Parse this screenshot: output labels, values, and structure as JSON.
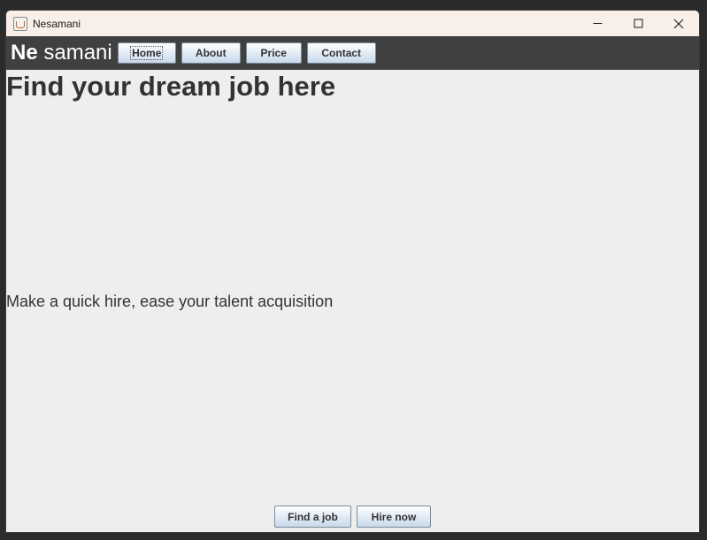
{
  "window": {
    "title": "Nesamani",
    "icon": "java-cup-icon"
  },
  "navbar": {
    "brand_bold": "Ne",
    "brand_light": "samani",
    "items": [
      {
        "label": "Home",
        "focused": true
      },
      {
        "label": "About"
      },
      {
        "label": "Price"
      },
      {
        "label": "Contact"
      }
    ]
  },
  "main": {
    "headline": "Find your dream job here",
    "tagline": "Make a quick hire, ease your talent acquisition"
  },
  "actions": {
    "find_job_label": "Find a job",
    "hire_now_label": "Hire now"
  },
  "colors": {
    "navbar_bg": "#404040",
    "content_bg": "#eeeeee",
    "titlebar_bg": "#f8efe9",
    "text": "#333333"
  }
}
